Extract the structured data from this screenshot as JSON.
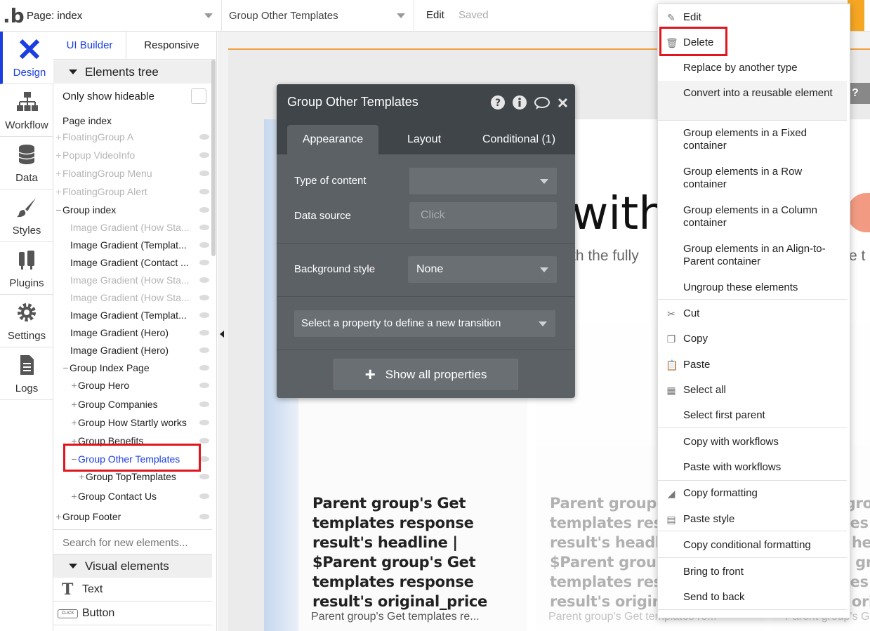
{
  "topbar": {
    "logo": ".b",
    "page_selector": "Page: index",
    "element_selector": "Group Other Templates",
    "edit_label": "Edit",
    "saved_label": "Saved"
  },
  "iconbar": {
    "items": [
      {
        "label": "Design",
        "icon": "design-icon"
      },
      {
        "label": "Workflow",
        "icon": "workflow-icon"
      },
      {
        "label": "Data",
        "icon": "database-icon"
      },
      {
        "label": "Styles",
        "icon": "brush-icon"
      },
      {
        "label": "Plugins",
        "icon": "plug-icon"
      },
      {
        "label": "Settings",
        "icon": "gear-icon"
      },
      {
        "label": "Logs",
        "icon": "document-icon"
      }
    ]
  },
  "tree": {
    "tab_ui_builder": "UI Builder",
    "tab_responsive": "Responsive",
    "elements_tree_title": "Elements tree",
    "only_show_hideable": "Only show hideable",
    "rows": [
      {
        "label": "Page index",
        "pm": "",
        "dim": false
      },
      {
        "label": "FloatingGroup A",
        "pm": "+",
        "dim": true
      },
      {
        "label": "Popup VideoInfo",
        "pm": "+",
        "dim": true
      },
      {
        "label": "FloatingGroup Menu",
        "pm": "+",
        "dim": true
      },
      {
        "label": "FloatingGroup Alert",
        "pm": "+",
        "dim": true
      },
      {
        "label": "Group index",
        "pm": "−",
        "dim": false
      },
      {
        "label": "Image Gradient (How Sta...",
        "pm": "",
        "dim": true
      },
      {
        "label": "Image Gradient (Templat...",
        "pm": "",
        "dim": false
      },
      {
        "label": "Image Gradient (Contact ...",
        "pm": "",
        "dim": false
      },
      {
        "label": "Image Gradient (How Sta...",
        "pm": "",
        "dim": true
      },
      {
        "label": "Image Gradient (How Sta...",
        "pm": "",
        "dim": true
      },
      {
        "label": "Image Gradient (Templat...",
        "pm": "",
        "dim": false
      },
      {
        "label": "Image Gradient (Hero)",
        "pm": "",
        "dim": false
      },
      {
        "label": "Image Gradient (Hero)",
        "pm": "",
        "dim": false
      },
      {
        "label": "Group Index Page",
        "pm": "−",
        "dim": false
      },
      {
        "label": "Group Hero",
        "pm": "+",
        "dim": false
      },
      {
        "label": "Group Companies",
        "pm": "+",
        "dim": false
      },
      {
        "label": "Group How Startly works",
        "pm": "+",
        "dim": false
      },
      {
        "label": "Group Benefits",
        "pm": "+",
        "dim": false
      },
      {
        "label": "Group Other Templates",
        "pm": "−",
        "dim": false
      },
      {
        "label": "Group TopTemplates",
        "pm": "+",
        "dim": false
      },
      {
        "label": "Group Contact Us",
        "pm": "+",
        "dim": false
      },
      {
        "label": "Group Footer",
        "pm": "+",
        "dim": false
      }
    ],
    "search_placeholder": "Search for new elements...",
    "visual_elements_title": "Visual elements",
    "visual_elements": [
      {
        "label": "Text",
        "icon": "text-icon"
      },
      {
        "label": "Button",
        "icon": "button-icon"
      }
    ]
  },
  "canvas": {
    "hero_text_fragment": "with",
    "hero_sub_fragment": "th the fully",
    "hero_sub_fragment_right": "e t",
    "card_headline": "Parent group's Get templates response result's headline | $Parent group's Get templates response result's original_price",
    "card_sub": "Parent group's Get templates re...",
    "help_tab": "?"
  },
  "editor": {
    "title": "Group Other Templates",
    "tabs": [
      "Appearance",
      "Layout",
      "Conditional (1)"
    ],
    "type_of_content_label": "Type of content",
    "type_of_content_value": "",
    "data_source_label": "Data source",
    "data_source_placeholder": "Click",
    "background_style_label": "Background style",
    "background_style_value": "None",
    "transition_placeholder": "Select a property to define a new transition",
    "show_all": "Show all properties"
  },
  "context_menu": {
    "items": [
      "Edit",
      "Delete",
      "Replace by another type",
      "Convert into a reusable element",
      "Group elements in a Fixed container",
      "Group elements in a Row container",
      "Group elements in a Column container",
      "Group elements in an Align-to-Parent container",
      "Ungroup these elements",
      "Cut",
      "Copy",
      "Paste",
      "Select all",
      "Select first parent",
      "Copy with workflows",
      "Paste with workflows",
      "Copy formatting",
      "Paste style",
      "Copy conditional formatting",
      "Bring to front",
      "Send to back"
    ]
  },
  "colors": {
    "accent_blue": "#1a3ee0",
    "highlight_red": "#e0151e",
    "editor_bg": "#5c6166",
    "editor_header": "#404549"
  }
}
